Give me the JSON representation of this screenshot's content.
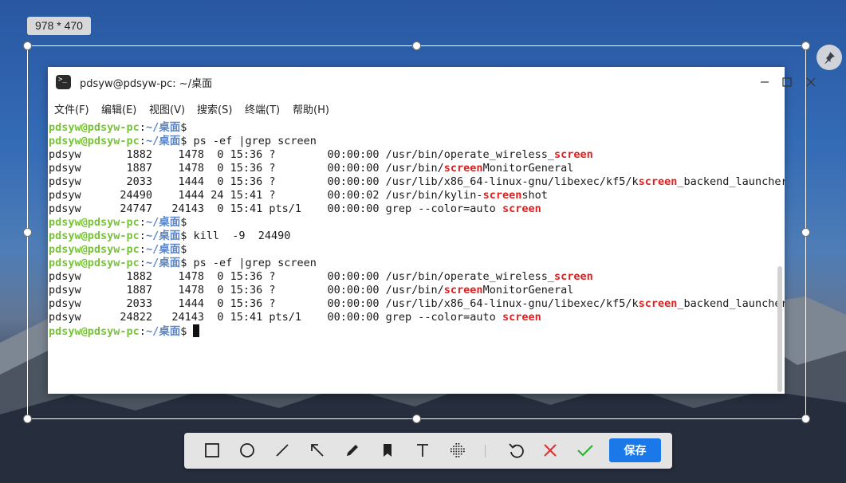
{
  "screenshot_tool": {
    "size_label": "978 * 470",
    "toolbar": {
      "save_label": "保存"
    }
  },
  "window": {
    "title": "pdsyw@pdsyw-pc: ~/桌面",
    "menu": [
      "文件(F)",
      "编辑(E)",
      "视图(V)",
      "搜索(S)",
      "终端(T)",
      "帮助(H)"
    ]
  },
  "terminal": {
    "lines": [
      [
        {
          "t": "pdsyw@pdsyw-pc",
          "c": "u"
        },
        {
          "t": ":"
        },
        {
          "t": "~/桌面",
          "c": "p"
        },
        {
          "t": "$ "
        }
      ],
      [
        {
          "t": "pdsyw@pdsyw-pc",
          "c": "u"
        },
        {
          "t": ":"
        },
        {
          "t": "~/桌面",
          "c": "p"
        },
        {
          "t": "$ ps -ef |grep screen"
        }
      ],
      [
        {
          "t": "pdsyw       1882    1478  0 15:36 ?        00:00:00 /usr/bin/operate_wireless_"
        },
        {
          "t": "screen",
          "c": "hl"
        }
      ],
      [
        {
          "t": "pdsyw       1887    1478  0 15:36 ?        00:00:00 /usr/bin/"
        },
        {
          "t": "screen",
          "c": "hl"
        },
        {
          "t": "MonitorGeneral"
        }
      ],
      [
        {
          "t": "pdsyw       2033    1444  0 15:36 ?        00:00:00 /usr/lib/x86_64-linux-gnu/libexec/kf5/k"
        },
        {
          "t": "screen",
          "c": "hl"
        },
        {
          "t": "_backend_launcher"
        }
      ],
      [
        {
          "t": "pdsyw      24490    1444 24 15:41 ?        00:00:02 /usr/bin/kylin-"
        },
        {
          "t": "screen",
          "c": "hl"
        },
        {
          "t": "shot"
        }
      ],
      [
        {
          "t": "pdsyw      24747   24143  0 15:41 pts/1    00:00:00 grep --color=auto "
        },
        {
          "t": "screen",
          "c": "hl"
        }
      ],
      [
        {
          "t": "pdsyw@pdsyw-pc",
          "c": "u"
        },
        {
          "t": ":"
        },
        {
          "t": "~/桌面",
          "c": "p"
        },
        {
          "t": "$ "
        }
      ],
      [
        {
          "t": "pdsyw@pdsyw-pc",
          "c": "u"
        },
        {
          "t": ":"
        },
        {
          "t": "~/桌面",
          "c": "p"
        },
        {
          "t": "$ kill  -9  24490"
        }
      ],
      [
        {
          "t": "pdsyw@pdsyw-pc",
          "c": "u"
        },
        {
          "t": ":"
        },
        {
          "t": "~/桌面",
          "c": "p"
        },
        {
          "t": "$ "
        }
      ],
      [
        {
          "t": "pdsyw@pdsyw-pc",
          "c": "u"
        },
        {
          "t": ":"
        },
        {
          "t": "~/桌面",
          "c": "p"
        },
        {
          "t": "$ ps -ef |grep screen"
        }
      ],
      [
        {
          "t": "pdsyw       1882    1478  0 15:36 ?        00:00:00 /usr/bin/operate_wireless_"
        },
        {
          "t": "screen",
          "c": "hl"
        }
      ],
      [
        {
          "t": "pdsyw       1887    1478  0 15:36 ?        00:00:00 /usr/bin/"
        },
        {
          "t": "screen",
          "c": "hl"
        },
        {
          "t": "MonitorGeneral"
        }
      ],
      [
        {
          "t": "pdsyw       2033    1444  0 15:36 ?        00:00:00 /usr/lib/x86_64-linux-gnu/libexec/kf5/k"
        },
        {
          "t": "screen",
          "c": "hl"
        },
        {
          "t": "_backend_launcher"
        }
      ],
      [
        {
          "t": "pdsyw      24822   24143  0 15:41 pts/1    00:00:00 grep --color=auto "
        },
        {
          "t": "screen",
          "c": "hl"
        }
      ],
      [
        {
          "t": "pdsyw@pdsyw-pc",
          "c": "u"
        },
        {
          "t": ":"
        },
        {
          "t": "~/桌面",
          "c": "p"
        },
        {
          "t": "$ "
        },
        {
          "cursor": true
        }
      ]
    ]
  },
  "colors": {
    "prompt_user": "#79c33a",
    "prompt_path": "#5b86c9",
    "match_highlight": "#e02020",
    "save_button": "#1a78e8",
    "cancel_icon": "#e03030",
    "confirm_icon": "#2cb52c"
  },
  "icons": {
    "toolbar": [
      "rectangle-icon",
      "ellipse-icon",
      "line-icon",
      "arrow-icon",
      "pen-icon",
      "marker-icon",
      "text-icon",
      "mosaic-icon",
      "undo-icon",
      "cancel-icon",
      "confirm-icon"
    ],
    "window": [
      "terminal-app-icon",
      "minimize-icon",
      "maximize-icon",
      "close-icon"
    ],
    "other": [
      "pin-icon"
    ]
  }
}
